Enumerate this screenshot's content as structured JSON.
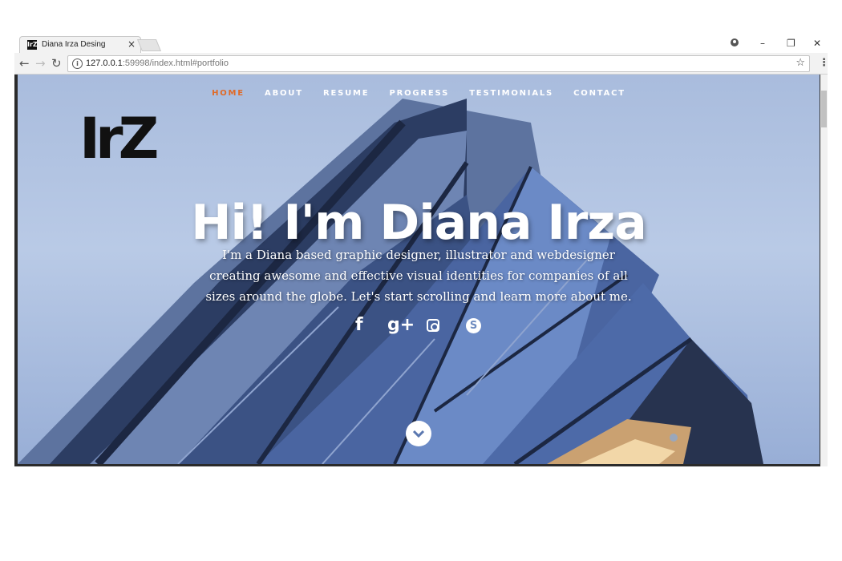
{
  "browser": {
    "tab_title": "Diana Irza Desing",
    "tab_close": "×",
    "favicon": "IrZ",
    "url_host": "127.0.0.1",
    "url_rest": ":59998/index.html#portfolio",
    "window_controls": {
      "minimize": "–",
      "restore": "❐",
      "close": "✕"
    },
    "icons": [
      "back-arrow-icon",
      "forward-arrow-icon",
      "reload-icon",
      "info-icon",
      "star-icon",
      "menu-dots-icon",
      "account-icon"
    ]
  },
  "site": {
    "nav": [
      "HOME",
      "ABOUT",
      "RESUME",
      "PROGRESS",
      "TESTIMONIALS",
      "CONTACT"
    ],
    "active_nav": "HOME",
    "logo_text": "IrZ",
    "headline": "Hi! I'm Diana Irza",
    "intro": "I'm a Diana based graphic designer, illustrator and webdesigner creating awesome and effective visual identities for companies of all sizes around the globe. Let's start scrolling and learn more about me.",
    "social": [
      "facebook-icon",
      "google-plus-icon",
      "instagram-icon",
      "skype-icon"
    ],
    "social_glyphs": {
      "facebook": "f",
      "google_plus": "g+",
      "skype": "S"
    },
    "colors": {
      "accent": "#e06a27",
      "text": "#ffffff",
      "sky": "#b9cae6"
    }
  }
}
